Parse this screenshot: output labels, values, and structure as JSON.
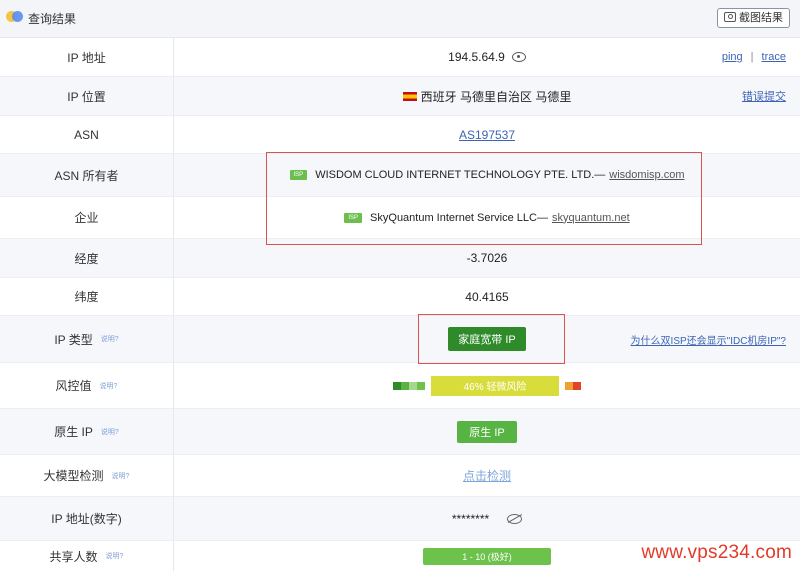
{
  "header": {
    "title": "查询结果",
    "screenshot_button": "截图结果"
  },
  "rows": {
    "ip": {
      "label": "IP 地址",
      "value": "194.5.64.9",
      "ping": "ping",
      "sep": "|",
      "trace": "trace"
    },
    "location": {
      "label": "IP 位置",
      "value": "西班牙 马德里自治区 马德里",
      "report": "错误提交"
    },
    "asn": {
      "label": "ASN",
      "value": "AS197537"
    },
    "asn_owner": {
      "label": "ASN 所有者",
      "badge": "ISP",
      "name": "WISDOM CLOUD INTERNET TECHNOLOGY PTE. LTD.—",
      "domain": "wisdomisp.com"
    },
    "company": {
      "label": "企业",
      "badge": "ISP",
      "name": "SkyQuantum Internet Service LLC—",
      "domain": "skyquantum.net"
    },
    "longitude": {
      "label": "经度",
      "value": "-3.7026"
    },
    "latitude": {
      "label": "纬度",
      "value": "40.4165"
    },
    "ip_type": {
      "label": "IP 类型",
      "note": "说明?",
      "value": "家庭宽带 IP",
      "why": "为什么双ISP还会显示\"IDC机房IP\"?"
    },
    "risk": {
      "label": "风控值",
      "note": "说明?",
      "value": "46%  轻微风险",
      "percent": 46
    },
    "native": {
      "label": "原生 IP",
      "note": "说明?",
      "value": "原生 IP"
    },
    "llm": {
      "label": "大模型检测",
      "note": "说明?",
      "value": "点击检测"
    },
    "ip_numeric": {
      "label": "IP 地址(数字)",
      "value": "********"
    },
    "shared": {
      "label": "共享人数",
      "note": "说明?",
      "value": "1 - 10 (极好)"
    }
  },
  "colors": {
    "accent_link": "#3c64b4",
    "type_badge": "#2f8a2a",
    "risk_bar": "#d9dd3c",
    "highlight_box": "#d9534f"
  },
  "watermark": "www.vps234.com"
}
